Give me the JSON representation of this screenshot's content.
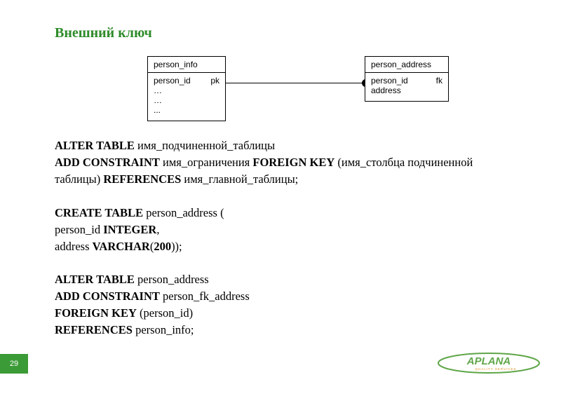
{
  "title": "Внешний ключ",
  "diagram": {
    "left": {
      "name": "person_info",
      "rows": [
        {
          "col": "person_id",
          "key": "pk"
        },
        {
          "col": "…",
          "key": ""
        },
        {
          "col": "…",
          "key": ""
        },
        {
          "col": "...",
          "key": ""
        }
      ]
    },
    "right": {
      "name": "person_address",
      "rows": [
        {
          "col": "person_id",
          "key": "fk"
        },
        {
          "col": "address",
          "key": ""
        }
      ]
    }
  },
  "code": {
    "l1a": "ALTER TABLE",
    "l1b": " имя_подчиненной_таблицы",
    "l2a": "ADD CONSTRAINT",
    "l2b": " имя_ограничения ",
    "l2c": "FOREIGN KEY",
    "l2d": " (имя_столбца подчиненной",
    "l3": "таблицы) ",
    "l3b": "REFERENCES",
    "l3c": " имя_главной_таблицы;",
    "blank1": " ",
    "l4a": "CREATE TABLE",
    "l4b": " person_address (",
    "l5a": "person_id ",
    "l5b": "INTEGER",
    "l5c": ",",
    "l6a": "address ",
    "l6b": "VARCHAR",
    "l6c": "(",
    "l6d": "200",
    "l6e": "));",
    "blank2": " ",
    "l7a": "ALTER TABLE",
    "l7b": " person_address",
    "l8a": "ADD CONSTRAINT",
    "l8b": " person_fk_address",
    "l9a": "FOREIGN KEY",
    "l9b": " (person_id)",
    "l10a": "REFERENCES",
    "l10b": " person_info;"
  },
  "page": "29",
  "logo": {
    "text": "APLANA",
    "sub": "QUALITY SERVICES"
  }
}
